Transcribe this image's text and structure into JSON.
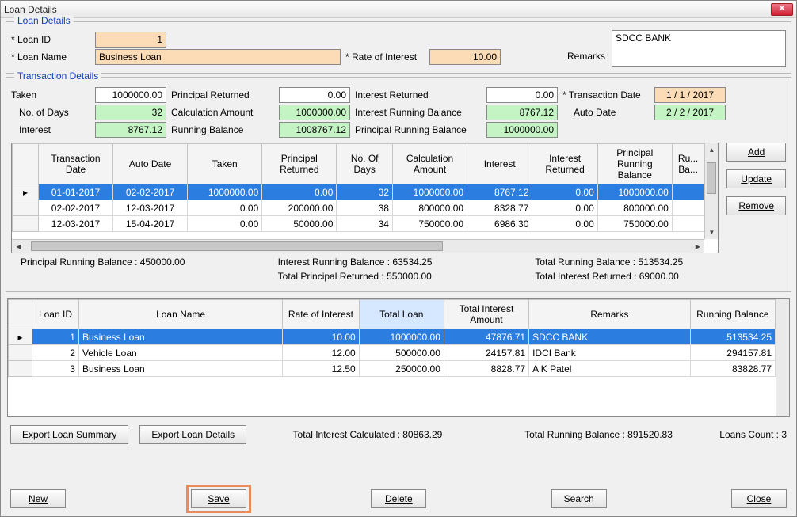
{
  "window": {
    "title": "Loan Details"
  },
  "loan_details": {
    "legend": "Loan Details",
    "loan_id_label": "* Loan ID",
    "loan_id": "1",
    "loan_name_label": "* Loan Name",
    "loan_name": "Business Loan",
    "rate_label": "* Rate of Interest",
    "rate": "10.00",
    "remarks_label": "Remarks",
    "remarks": "SDCC BANK"
  },
  "txn_details": {
    "legend": "Transaction Details",
    "taken_label": "Taken",
    "taken": "1000000.00",
    "principal_returned_label": "Principal Returned",
    "principal_returned": "0.00",
    "interest_returned_label": "Interest Returned",
    "interest_returned": "0.00",
    "txn_date_label": "* Transaction Date",
    "txn_date": "1 / 1 / 2017",
    "no_days_label": "No. of Days",
    "no_days": "32",
    "calc_amount_label": "Calculation Amount",
    "calc_amount": "1000000.00",
    "int_run_bal_label": "Interest Running Balance",
    "int_run_bal": "8767.12",
    "auto_date_label": "Auto Date",
    "auto_date": "2 / 2 / 2017",
    "interest_label": "Interest",
    "interest": "8767.12",
    "running_balance_label": "Running Balance",
    "running_balance": "1008767.12",
    "prin_run_bal_label": "Principal Running Balance",
    "prin_run_bal": "1000000.00",
    "buttons": {
      "add": "Add",
      "update": "Update",
      "remove": "Remove"
    },
    "grid": {
      "headers": [
        "Transaction Date",
        "Auto Date",
        "Taken",
        "Principal Returned",
        "No. Of Days",
        "Calculation Amount",
        "Interest",
        "Interest Returned",
        "Principal Running Balance",
        "Running Balance"
      ],
      "header_trunc_last": "Ru... Ba...",
      "rows": [
        {
          "txn": "01-01-2017",
          "auto": "02-02-2017",
          "taken": "1000000.00",
          "pr": "0.00",
          "days": "32",
          "calc": "1000000.00",
          "int": "8767.12",
          "ir": "0.00",
          "prb": "1000000.00"
        },
        {
          "txn": "02-02-2017",
          "auto": "12-03-2017",
          "taken": "0.00",
          "pr": "200000.00",
          "days": "38",
          "calc": "800000.00",
          "int": "8328.77",
          "ir": "0.00",
          "prb": "800000.00"
        },
        {
          "txn": "12-03-2017",
          "auto": "15-04-2017",
          "taken": "0.00",
          "pr": "50000.00",
          "days": "34",
          "calc": "750000.00",
          "int": "6986.30",
          "ir": "0.00",
          "prb": "750000.00"
        }
      ]
    },
    "summary": {
      "prin_run_bal": "Principal Running Balance : 450000.00",
      "int_run_bal": "Interest Running Balance : 63534.25",
      "total_run_bal": "Total Running Balance : 513534.25",
      "total_prin_ret": "Total Principal Returned : 550000.00",
      "total_int_ret": "Total Interest Returned : 69000.00"
    }
  },
  "loans_grid": {
    "headers": [
      "Loan ID",
      "Loan Name",
      "Rate of Interest",
      "Total Loan",
      "Total Interest Amount",
      "Remarks",
      "Running Balance"
    ],
    "rows": [
      {
        "id": "1",
        "name": "Business Loan",
        "rate": "10.00",
        "total": "1000000.00",
        "tia": "47876.71",
        "rem": "SDCC BANK",
        "rb": "513534.25"
      },
      {
        "id": "2",
        "name": "Vehicle Loan",
        "rate": "12.00",
        "total": "500000.00",
        "tia": "24157.81",
        "rem": "IDCI Bank",
        "rb": "294157.81"
      },
      {
        "id": "3",
        "name": "Business Loan",
        "rate": "12.50",
        "total": "250000.00",
        "tia": "8828.77",
        "rem": "A K Patel",
        "rb": "83828.77"
      }
    ]
  },
  "footer": {
    "total_int_calc": "Total Interest Calculated : 80863.29",
    "total_run_bal": "Total Running Balance : 891520.83",
    "loans_count": "Loans Count : 3",
    "export_summary": "Export Loan Summary",
    "export_details": "Export Loan Details",
    "new": "New",
    "save": "Save",
    "delete": "Delete",
    "search": "Search",
    "close": "Close"
  }
}
